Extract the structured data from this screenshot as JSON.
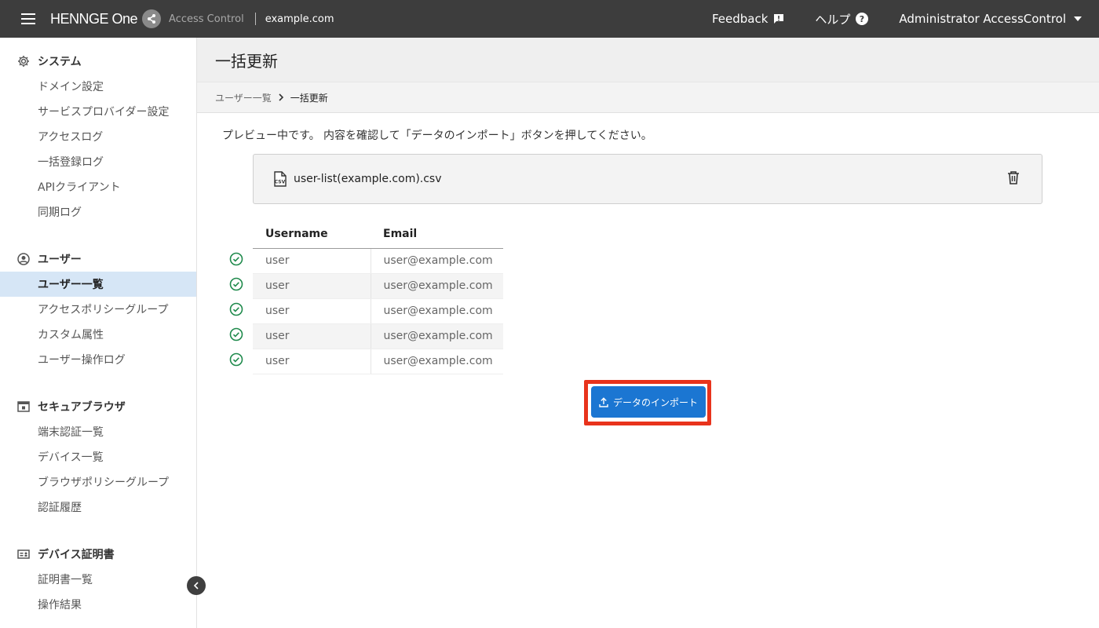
{
  "topbar": {
    "logo_text": "HENNGE One",
    "product": "Access Control",
    "domain": "example.com",
    "feedback_label": "Feedback",
    "help_label": "ヘルプ",
    "user_label": "Administrator AccessControl"
  },
  "sidebar": {
    "sections": [
      {
        "title": "システム",
        "items": [
          "ドメイン設定",
          "サービスプロバイダー設定",
          "アクセスログ",
          "一括登録ログ",
          "APIクライアント",
          "同期ログ"
        ]
      },
      {
        "title": "ユーザー",
        "items": [
          "ユーザー一覧",
          "アクセスポリシーグループ",
          "カスタム属性",
          "ユーザー操作ログ"
        ]
      },
      {
        "title": "セキュアブラウザ",
        "items": [
          "端末認証一覧",
          "デバイス一覧",
          "ブラウザポリシーグループ",
          "認証履歴"
        ]
      },
      {
        "title": "デバイス証明書",
        "items": [
          "証明書一覧",
          "操作結果"
        ]
      }
    ],
    "active_item": "ユーザー一覧"
  },
  "page": {
    "title": "一括更新",
    "breadcrumb": [
      "ユーザー一覧",
      "一括更新"
    ],
    "instruction": "プレビュー中です。 内容を確認して「データのインポート」ボタンを押してください。",
    "file_name": "user-list(example.com).csv",
    "file_icon_label": "CSV"
  },
  "table": {
    "headers": [
      "Username",
      "Email"
    ],
    "rows": [
      {
        "status": "valid",
        "username": "user",
        "email": "user@example.com"
      },
      {
        "status": "valid",
        "username": "user",
        "email": "user@example.com"
      },
      {
        "status": "valid",
        "username": "user",
        "email": "user@example.com"
      },
      {
        "status": "valid",
        "username": "user",
        "email": "user@example.com"
      },
      {
        "status": "valid",
        "username": "user",
        "email": "user@example.com"
      }
    ]
  },
  "import_button": {
    "label": "データのインポート"
  },
  "colors": {
    "topbar": "#3d3d3d",
    "accent": "#1b76d2",
    "highlight": "#e8331c",
    "active_nav": "#d6e6f6",
    "success": "#1f8a4c"
  }
}
